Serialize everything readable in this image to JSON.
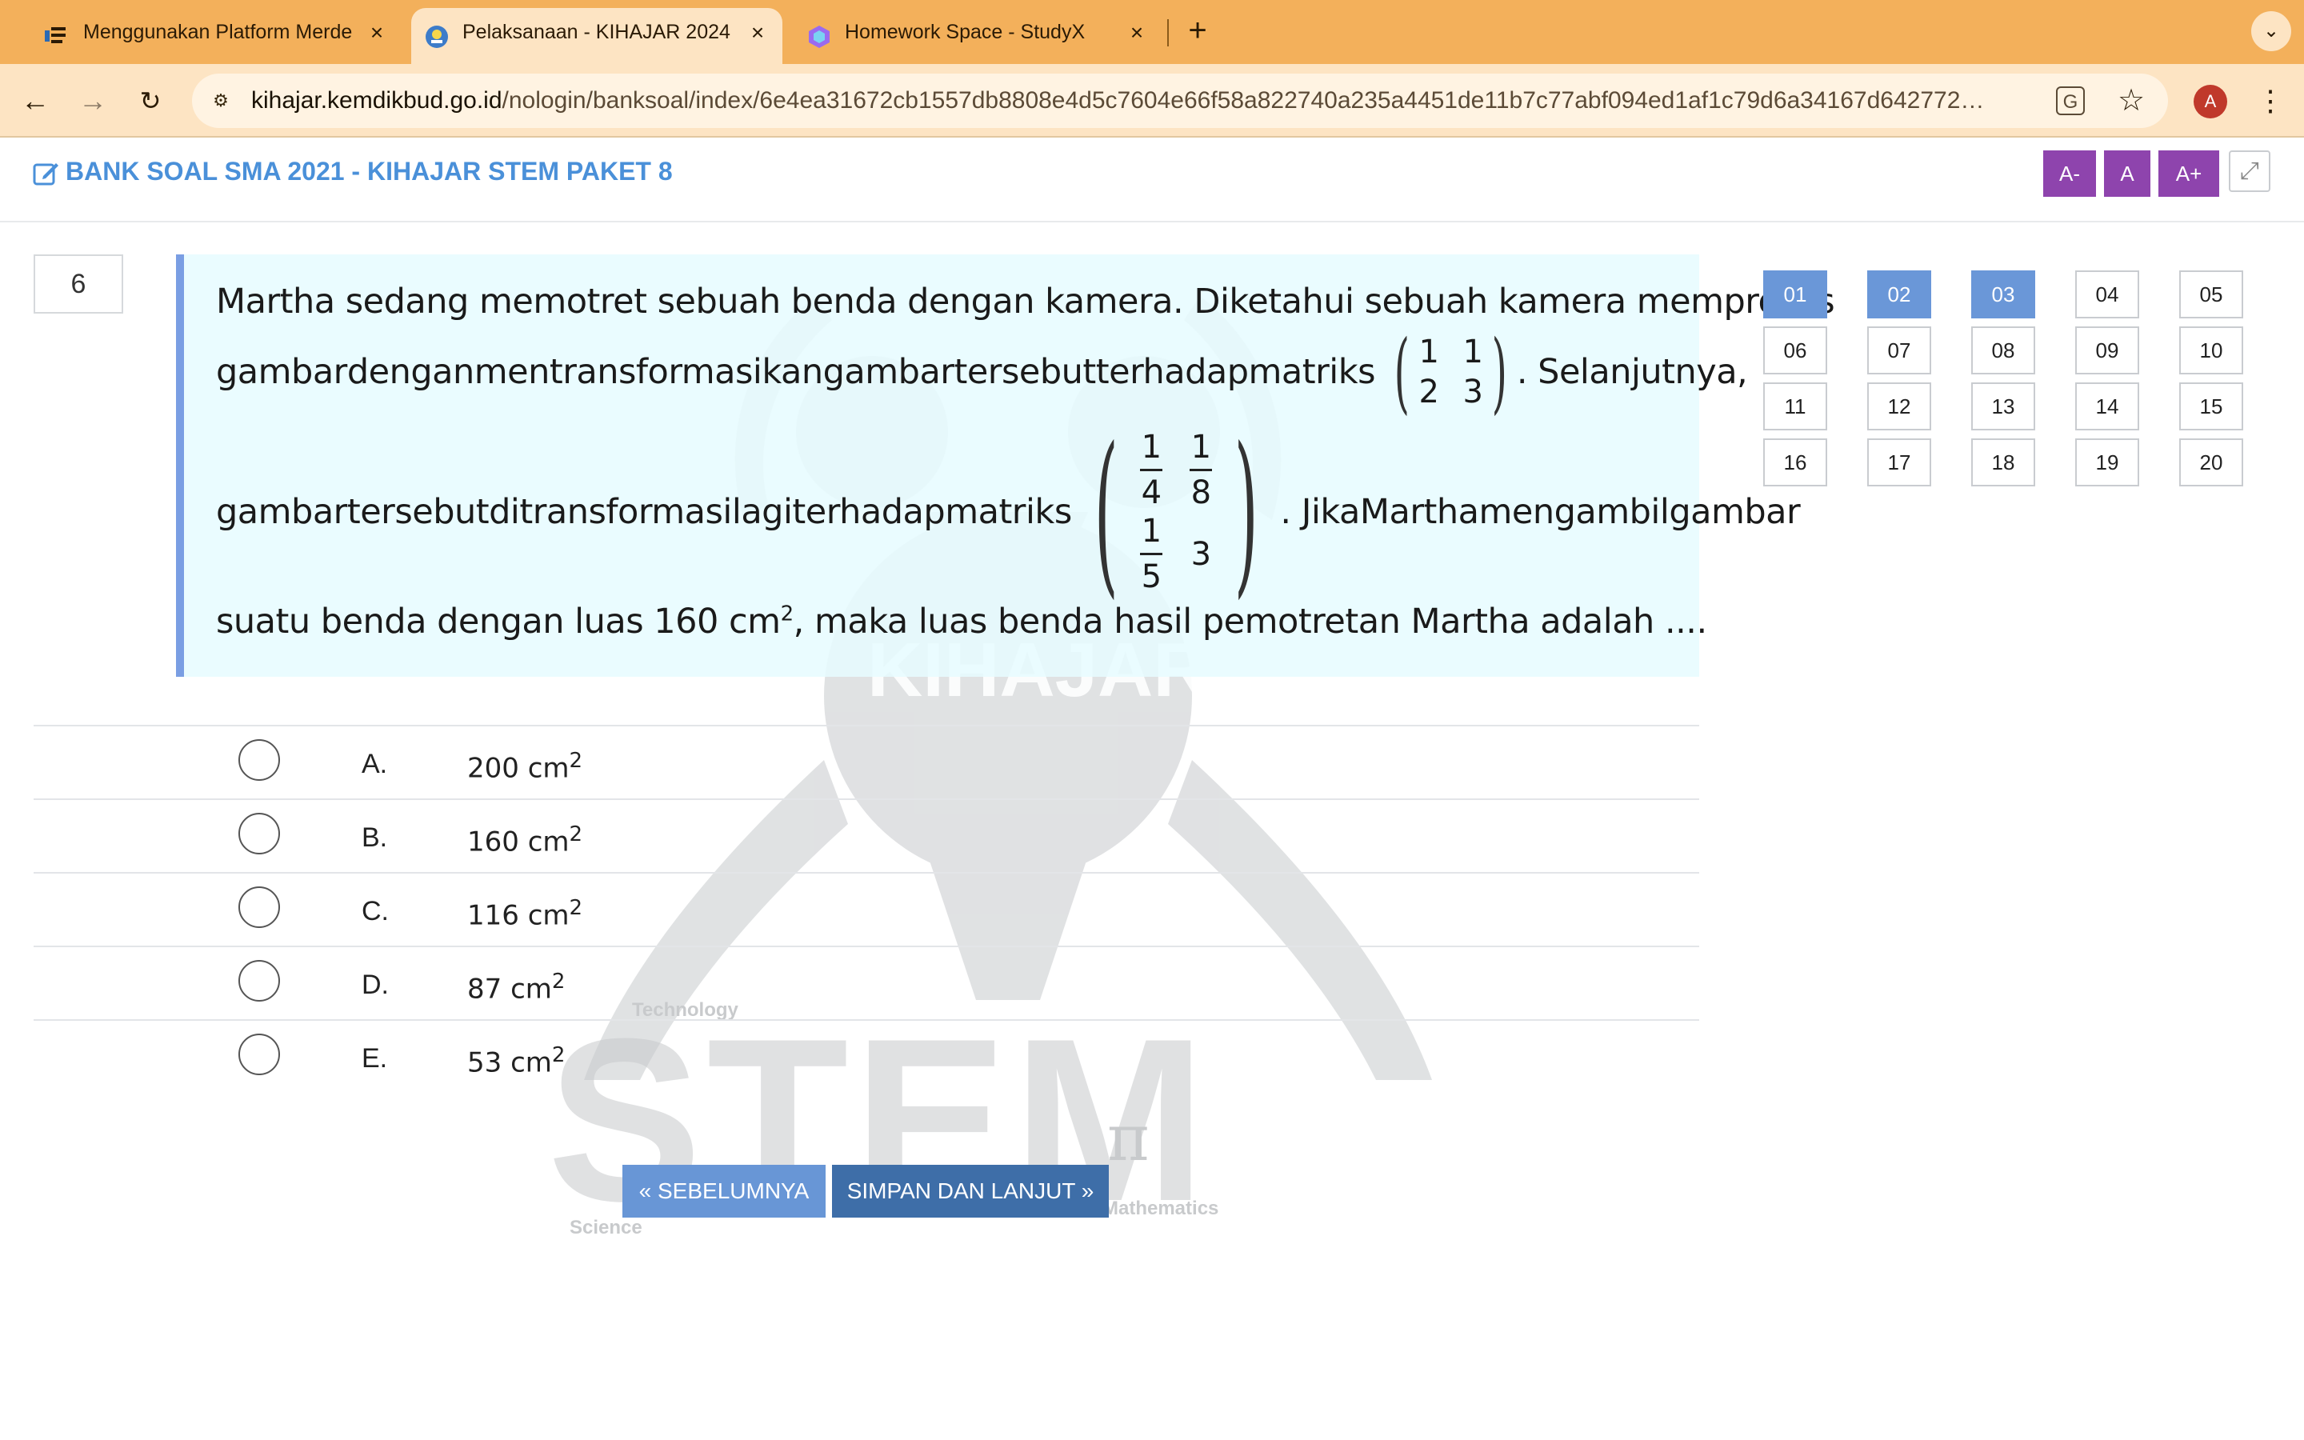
{
  "browser": {
    "tabs": [
      {
        "title": "Menggunakan Platform Merde",
        "active": false
      },
      {
        "title": "Pelaksanaan - KIHAJAR 2024",
        "active": true
      },
      {
        "title": "Homework Space - StudyX",
        "active": false
      }
    ],
    "url_host": "kihajar.kemdikbud.go.id",
    "url_path": "/nologin/banksoal/index/6e4ea31672cb1557db8808e4d5c7604e66f58a822740a235a4451de11b7c77abf094ed1af1c79d6a34167d642772896d...",
    "profile_initial": "A",
    "accent_color": "#f3b05b"
  },
  "header": {
    "title": "BANK SOAL SMA 2021 - KIHAJAR STEM PAKET 8",
    "font_buttons": [
      "A-",
      "A",
      "A+"
    ]
  },
  "question": {
    "number": "6",
    "line1": "Martha sedang memotret sebuah benda dengan kamera. Diketahui sebuah kamera memproses",
    "line2_words": [
      "gambar",
      "dengan",
      "mentransformasikan",
      "gambar",
      "tersebut",
      "terhadap",
      "matriks"
    ],
    "matrix1": [
      "1",
      "1",
      "2",
      "3"
    ],
    "line2_tail": ". Selanjutnya,",
    "line3_words": [
      "gambar",
      "tersebut",
      "ditransformasi",
      "lagi",
      "terhadap",
      "matriks"
    ],
    "matrix2": {
      "a_num": "1",
      "a_den": "4",
      "b_num": "1",
      "b_den": "8",
      "c_num": "1",
      "c_den": "5",
      "d": "3"
    },
    "line3_tail_words": [
      ". Jika",
      "Martha",
      "mengambil",
      "gambar"
    ],
    "line4_pre": "suatu benda dengan luas 160 cm",
    "line4_sup": "2",
    "line4_post": ", maka luas benda hasil pemotretan Martha adalah ...."
  },
  "options": [
    {
      "letter": "A.",
      "value": "200 cm",
      "sup": "2"
    },
    {
      "letter": "B.",
      "value": "160 cm",
      "sup": "2"
    },
    {
      "letter": "C.",
      "value": "116 cm",
      "sup": "2"
    },
    {
      "letter": "D.",
      "value": "87 cm",
      "sup": "2"
    },
    {
      "letter": "E.",
      "value": "53 cm",
      "sup": "2"
    }
  ],
  "buttons": {
    "prev": "« SEBELUMNYA",
    "next": "SIMPAN DAN LANJUT »"
  },
  "watermark": {
    "kihajar": "KIHAJAR",
    "stem": "STEM",
    "technology": "Technology",
    "science": "Science",
    "mathematics": "Mathematics",
    "pi": "π"
  },
  "navigator": {
    "items": [
      "01",
      "02",
      "03",
      "04",
      "05",
      "06",
      "07",
      "08",
      "09",
      "10",
      "11",
      "12",
      "13",
      "14",
      "15",
      "16",
      "17",
      "18",
      "19",
      "20"
    ],
    "answered": [
      "01",
      "02",
      "03"
    ],
    "answered_color": "#6a97d8"
  }
}
